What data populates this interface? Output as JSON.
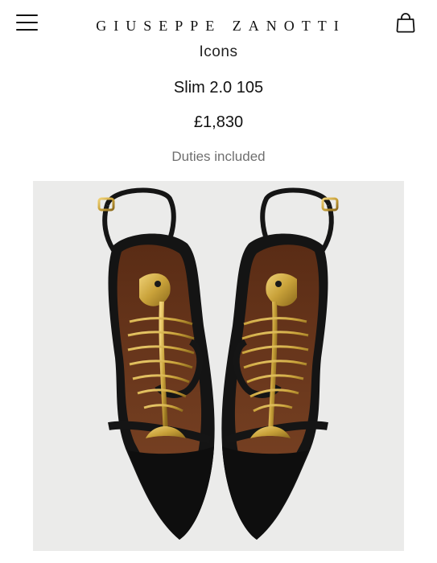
{
  "header": {
    "brand": "GIUSEPPE ZANOTTI",
    "menu_icon": "hamburger-menu-icon",
    "bag_icon": "shopping-bag-icon"
  },
  "product": {
    "category": "Icons",
    "name": "Slim 2.0 105",
    "price": "£1,830",
    "duties_note": "Duties included",
    "image_alt": "pair of black leather sandals with gold fish bone embellishment"
  },
  "colors": {
    "background": "#ffffff",
    "image_background": "#ebebea",
    "text": "#111111",
    "muted_text": "#6f6f6f",
    "leather_black": "#151515",
    "footbed_brown": "#6e3a1e",
    "gold": "#c9a23a"
  }
}
